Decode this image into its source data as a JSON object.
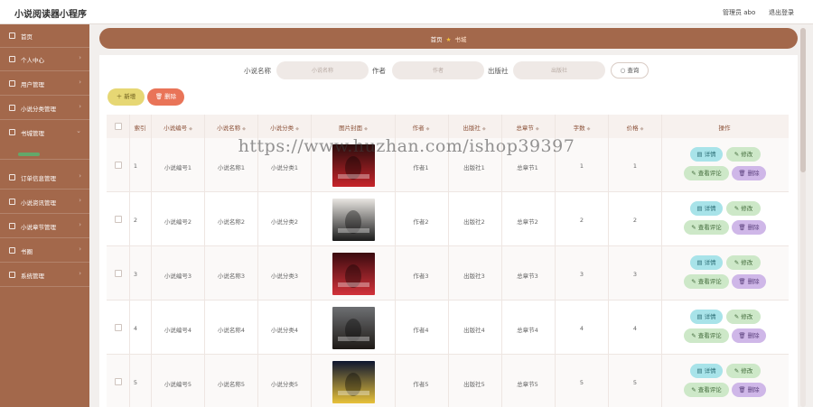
{
  "header": {
    "app_title": "小说阅读器小程序",
    "admin_text": "管理员 abo",
    "logout": "退出登录"
  },
  "sidebar": {
    "items": [
      {
        "label": "首页",
        "has_arrow": false
      },
      {
        "label": "个人中心",
        "has_arrow": true
      },
      {
        "label": "用户管理",
        "has_arrow": true
      },
      {
        "label": "小说分类管理",
        "has_arrow": true
      },
      {
        "label": "书城管理",
        "has_arrow": true
      },
      {
        "label": "订单信息管理",
        "has_arrow": true
      },
      {
        "label": "小说资讯管理",
        "has_arrow": true
      },
      {
        "label": "小说章节管理",
        "has_arrow": true
      },
      {
        "label": "书圈",
        "has_arrow": true
      },
      {
        "label": "系统管理",
        "has_arrow": true
      }
    ]
  },
  "breadcrumb": {
    "home": "首页",
    "current": "书城"
  },
  "filters": {
    "name_label": "小说名称",
    "name_placeholder": "小说名称",
    "author_label": "作者",
    "author_placeholder": "作者",
    "publisher_label": "出版社",
    "publisher_placeholder": "出版社",
    "search_button": "查询"
  },
  "toolbar": {
    "add_label": "新增",
    "delete_label": "删除"
  },
  "table": {
    "columns": [
      "索引",
      "小说编号",
      "小说名称",
      "小说分类",
      "图片封面",
      "作者",
      "出版社",
      "总章节",
      "字数",
      "价格",
      "操作"
    ],
    "rows": [
      {
        "index": "1",
        "code": "小说编号1",
        "name": "小说名称1",
        "category": "小说分类1",
        "author": "作者1",
        "publisher": "出版社1",
        "chapters": "总章节1",
        "words": "1",
        "price": "1",
        "cover_colors": [
          "#2a0c0c",
          "#c6242a"
        ]
      },
      {
        "index": "2",
        "code": "小说编号2",
        "name": "小说名称2",
        "category": "小说分类2",
        "author": "作者2",
        "publisher": "出版社2",
        "chapters": "总章节2",
        "words": "2",
        "price": "2",
        "cover_colors": [
          "#e9e6e2",
          "#1b1b1b"
        ]
      },
      {
        "index": "3",
        "code": "小说编号3",
        "name": "小说名称3",
        "category": "小说分类3",
        "author": "作者3",
        "publisher": "出版社3",
        "chapters": "总章节3",
        "words": "3",
        "price": "3",
        "cover_colors": [
          "#3b0b0f",
          "#d2323a"
        ]
      },
      {
        "index": "4",
        "code": "小说编号4",
        "name": "小说名称4",
        "category": "小说分类4",
        "author": "作者4",
        "publisher": "出版社4",
        "chapters": "总章节4",
        "words": "4",
        "price": "4",
        "cover_colors": [
          "#6d6f72",
          "#1e1a16"
        ]
      },
      {
        "index": "5",
        "code": "小说编号5",
        "name": "小说名称5",
        "category": "小说分类5",
        "author": "作者5",
        "publisher": "出版社5",
        "chapters": "总章节5",
        "words": "5",
        "price": "5",
        "cover_colors": [
          "#0e1630",
          "#e8c23a"
        ]
      }
    ],
    "actions": {
      "detail": "详情",
      "edit": "修改",
      "comments": "查看评论",
      "delete": "删除"
    }
  },
  "watermark": "https://www.huzhan.com/ishop39397",
  "colors": {
    "sidebar": "#a3684b",
    "accent_add": "#e6d774",
    "accent_delete": "#e97458",
    "detail": "#a8e3e9",
    "edit": "#cde8c8",
    "remove": "#cfb7e8"
  }
}
